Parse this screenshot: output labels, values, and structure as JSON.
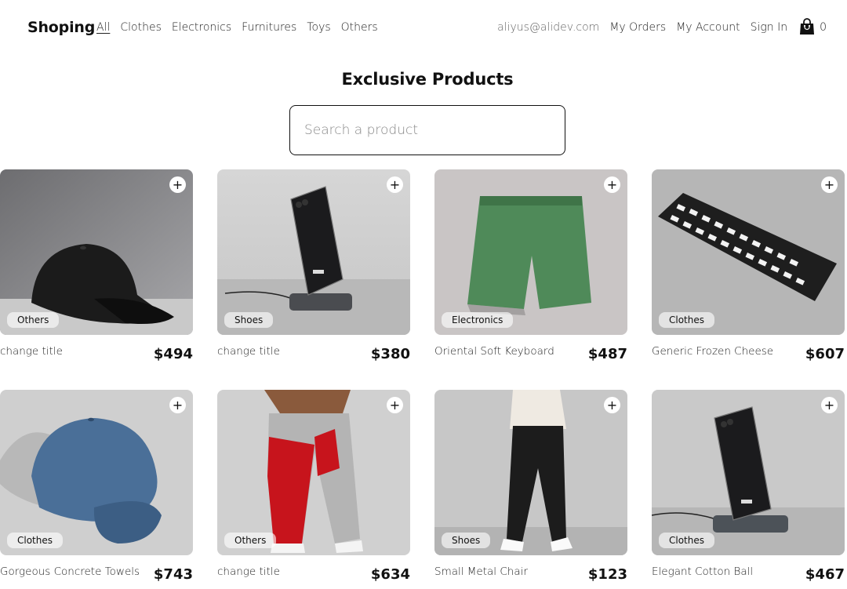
{
  "nav": {
    "brand": "Shoping",
    "categories": [
      "All",
      "Clothes",
      "Electronics",
      "Furnitures",
      "Toys",
      "Others"
    ],
    "active_category": "All",
    "email": "aliyus@alidev.com",
    "my_orders": "My Orders",
    "my_account": "My Account",
    "sign_in": "Sign In",
    "cart_count": "0"
  },
  "main": {
    "title": "Exclusive Products",
    "search_placeholder": "Search a product"
  },
  "products": [
    {
      "name": "change title",
      "price": "$494",
      "category": "Others",
      "image": "black-cap"
    },
    {
      "name": "change title",
      "price": "$380",
      "category": "Shoes",
      "image": "phone-on-stand"
    },
    {
      "name": "Oriental Soft Keyboard",
      "price": "$487",
      "category": "Electronics",
      "image": "green-shorts"
    },
    {
      "name": "Generic Frozen Cheese",
      "price": "$607",
      "category": "Clothes",
      "image": "keyboard"
    },
    {
      "name": "Gorgeous Concrete Towels",
      "price": "$743",
      "category": "Clothes",
      "image": "blue-cap"
    },
    {
      "name": "change title",
      "price": "$634",
      "category": "Others",
      "image": "colorblock-joggers"
    },
    {
      "name": "Small Metal Chair",
      "price": "$123",
      "category": "Shoes",
      "image": "black-joggers"
    },
    {
      "name": "Elegant Cotton Ball",
      "price": "$467",
      "category": "Clothes",
      "image": "phone-on-stand"
    }
  ],
  "icons": {
    "add": "plus-icon",
    "cart": "shopping-bag-icon"
  },
  "add_symbol": "+"
}
